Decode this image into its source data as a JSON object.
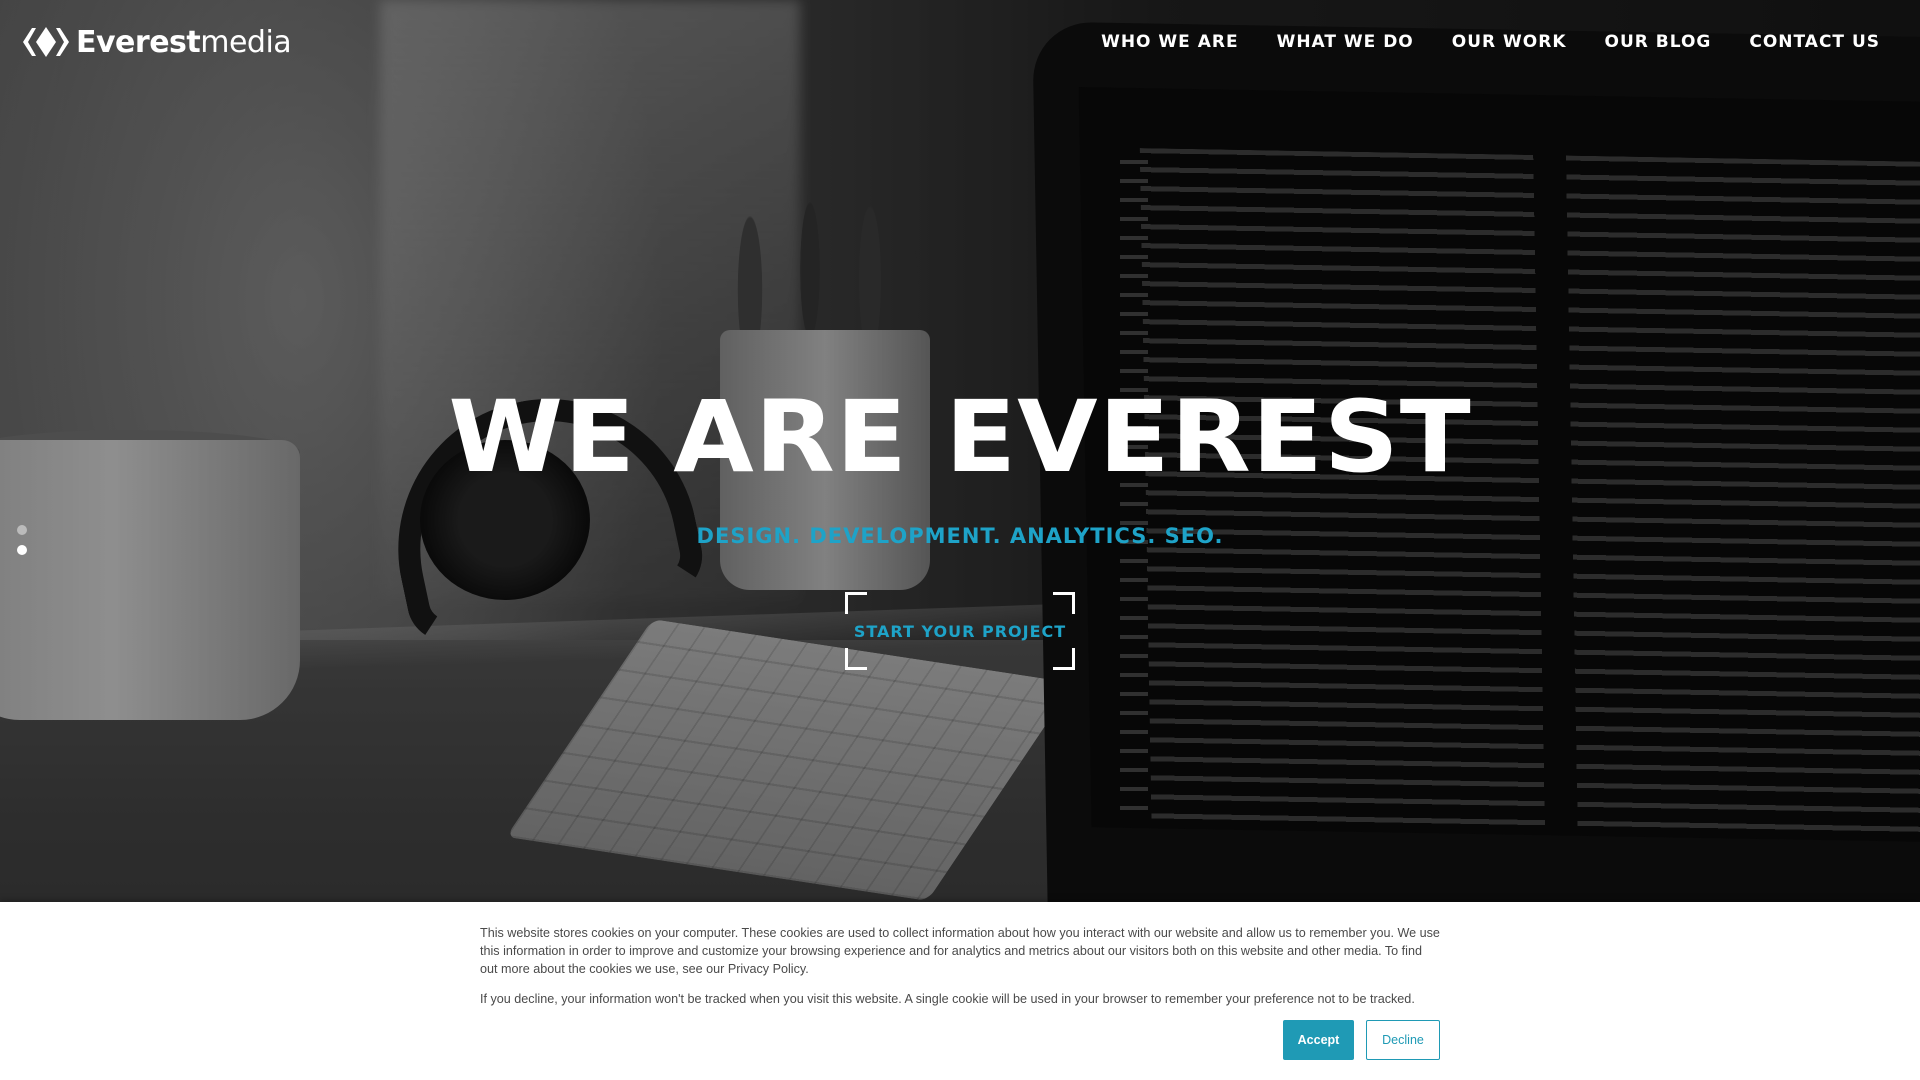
{
  "brand": {
    "name_bold": "Everest",
    "name_light": "media",
    "logo_icon": "everest-diamond-logo-icon"
  },
  "nav": {
    "items": [
      {
        "label": "WHO WE ARE"
      },
      {
        "label": "WHAT WE DO"
      },
      {
        "label": "OUR WORK"
      },
      {
        "label": "OUR BLOG"
      },
      {
        "label": "CONTACT US"
      }
    ]
  },
  "hero": {
    "title": "WE ARE EVEREST",
    "subtitle": "DESIGN. DEVELOPMENT. ANALYTICS. SEO.",
    "cta_label": "START YOUR PROJECT",
    "slides": {
      "count": 2,
      "active": 2
    }
  },
  "cookie_banner": {
    "paragraph_1": "This website stores cookies on your computer. These cookies are used to collect information about how you interact with our website and allow us to remember you. We use this information in order to improve and customize your browsing experience and for analytics and metrics about our visitors both on this website and other media. To find out more about the cookies we use, see our Privacy Policy.",
    "paragraph_2": "If you decline, your information won't be tracked when you visit this website. A single cookie will be used in your browser to remember your preference not to be tracked.",
    "accept_label": "Accept",
    "decline_label": "Decline"
  },
  "colors": {
    "accent": "#1ea3c8",
    "button": "#1f9ab5",
    "text_white": "#ffffff",
    "banner_text": "#4a4a4a"
  }
}
